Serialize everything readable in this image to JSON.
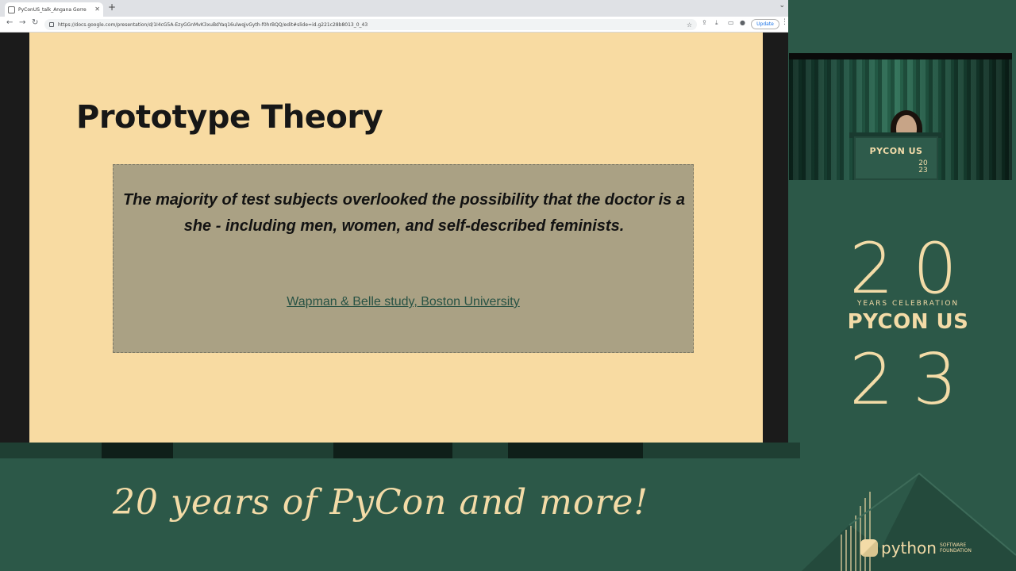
{
  "browser": {
    "tab_title": "PyConUS_talk_Angana Gorre",
    "new_tab_symbol": "+",
    "url": "https://docs.google.com/presentation/d/1I4cG5A-EzyGGnMvK3xuBdYaq16ulwqjvGyth-f0hrBQQ/edit#slide=id.g221c28b8013_0_43",
    "update_label": "Update",
    "icons": {
      "back": "back-arrow-icon",
      "forward": "forward-arrow-icon",
      "reload": "reload-icon",
      "bookmark": "star-icon",
      "menu": "three-dots-icon"
    }
  },
  "slide": {
    "title": "Prototype Theory",
    "quote": "The majority of test subjects overlooked the possibility that the doctor is a she - including men, women, and self-described feminists.",
    "source_link": "Wapman & Belle study, Boston University"
  },
  "speaker_video": {
    "podium_brand": "PYCON US",
    "podium_year": "20 23"
  },
  "brand_panel": {
    "year_top": "20",
    "celebration": "YEARS CELEBRATION",
    "brand_name": "PYCON US",
    "year_bottom": "23"
  },
  "banner": {
    "tagline": "20 years of PyCon and more!",
    "psf_word": "python",
    "psf_sub_1": "SOFTWARE",
    "psf_sub_2": "FOUNDATION"
  },
  "colors": {
    "slide_bg": "#f8dba2",
    "quote_box": "#aaa184",
    "brand_green": "#2c5848",
    "brand_cream": "#f3dba7",
    "link": "#285244"
  }
}
